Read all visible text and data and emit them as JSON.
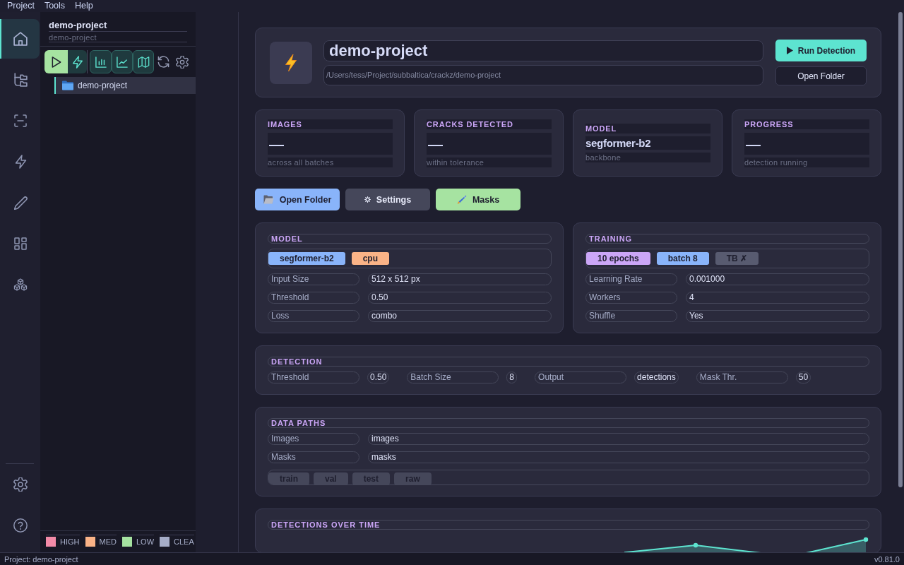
{
  "menu_bar": [
    "Project",
    "Tools",
    "Help"
  ],
  "activity_bar": {
    "items": [
      {
        "selected": true
      },
      {
        "selected": false
      },
      {
        "selected": false
      },
      {
        "selected": false
      },
      {
        "selected": false
      },
      {
        "selected": false
      },
      {
        "selected": false
      }
    ]
  },
  "sidebar": {
    "project_name": "demo-project",
    "project_subtitle": "demo-project",
    "toolbar": [
      {
        "kind": "run"
      },
      {
        "kind": "action"
      },
      {
        "kind": "view"
      },
      {
        "kind": "view"
      },
      {
        "kind": "view"
      },
      {
        "kind": "plain"
      },
      {
        "kind": "plain"
      }
    ],
    "tree": [
      {
        "label": "demo-project",
        "selected": true
      }
    ],
    "legend": [
      {
        "label": "HIGH",
        "color": "#f38ba8"
      },
      {
        "label": "MED",
        "color": "#fab387"
      },
      {
        "label": "LOW",
        "color": "#a6e3a1"
      },
      {
        "label": "CLEA",
        "color": "#a6adc8"
      }
    ]
  },
  "header": {
    "title": "demo-project",
    "path": "/Users/tess/Project/subbaltica/crackz/demo-project",
    "buttons": [
      {
        "label": "Run Detection",
        "kind": "primary"
      },
      {
        "label": "Open Folder",
        "kind": "secondary"
      }
    ]
  },
  "stats": [
    {
      "label": "IMAGES",
      "value": "—",
      "kind": "empty",
      "caption": "across all batches"
    },
    {
      "label": "CRACKS DETECTED",
      "value": "—",
      "kind": "empty",
      "caption": "within tolerance"
    },
    {
      "label": "MODEL",
      "value": "segformer-b2",
      "kind": "text",
      "caption": "backbone"
    },
    {
      "label": "PROGRESS",
      "value": "—",
      "kind": "empty",
      "caption": "detection running"
    }
  ],
  "actions": [
    {
      "label": "Open Folder",
      "color": "#89b4fa"
    },
    {
      "label": "Settings",
      "color": "#45475a"
    },
    {
      "label": "Masks",
      "color": "#a6e3a1"
    }
  ],
  "model": {
    "title": "MODEL",
    "tags": [
      {
        "label": "segformer-b2",
        "color": "#89b4fa"
      },
      {
        "label": "cpu",
        "color": "#fab387"
      }
    ],
    "rows": [
      {
        "label": "Input Size",
        "value": "512 x 512 px"
      },
      {
        "label": "Threshold",
        "value": "0.50"
      },
      {
        "label": "Loss",
        "value": "combo"
      }
    ]
  },
  "training": {
    "title": "TRAINING",
    "tags": [
      {
        "label": "10 epochs",
        "color": "#cba6f7"
      },
      {
        "label": "batch 8",
        "color": "#89b4fa"
      },
      {
        "label": "TB ✗",
        "color": "#585b70"
      }
    ],
    "rows": [
      {
        "label": "Learning Rate",
        "value": "0.001000"
      },
      {
        "label": "Workers",
        "value": "4"
      },
      {
        "label": "Shuffle",
        "value": "Yes"
      }
    ]
  },
  "detection": {
    "title": "DETECTION",
    "fields": [
      {
        "label": "Threshold",
        "value": "0.50"
      },
      {
        "label": "Batch Size",
        "value": "8"
      },
      {
        "label": "Output",
        "value": "detections"
      },
      {
        "label": "Mask Thr.",
        "value": "50"
      }
    ]
  },
  "data_paths": {
    "title": "DATA PATHS",
    "rows": [
      {
        "label": "Images",
        "value": "images"
      },
      {
        "label": "Masks",
        "value": "masks"
      }
    ],
    "splits": [
      "train",
      "val",
      "test",
      "raw"
    ]
  },
  "chart": {
    "title": "DETECTIONS OVER TIME"
  },
  "status_bar": {
    "left": "Project: demo-project",
    "right": "v0.81.0"
  }
}
